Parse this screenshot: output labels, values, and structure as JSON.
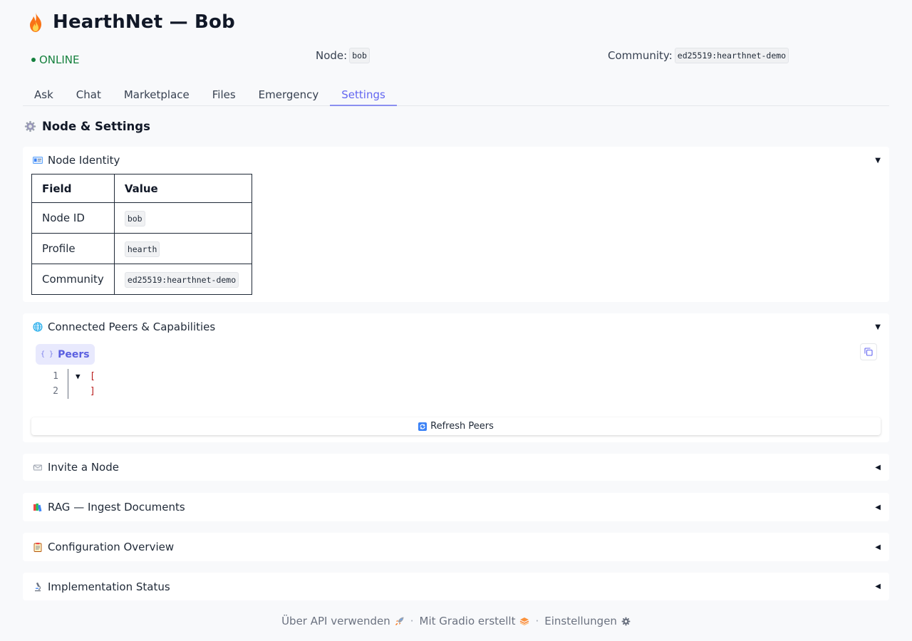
{
  "header": {
    "title": "HearthNet — Bob",
    "status": "ONLINE",
    "node_label": "Node:",
    "node_value": "bob",
    "community_label": "Community:",
    "community_value": "ed25519:hearthnet-demo"
  },
  "tabs": [
    {
      "label": "Ask"
    },
    {
      "label": "Chat"
    },
    {
      "label": "Marketplace"
    },
    {
      "label": "Files"
    },
    {
      "label": "Emergency"
    },
    {
      "label": "Settings",
      "active": true
    }
  ],
  "section": {
    "title": "Node & Settings",
    "icon": "gear-icon"
  },
  "node_identity": {
    "title": "Node Identity",
    "icon": "id-card-icon",
    "headers": [
      "Field",
      "Value"
    ],
    "rows": [
      {
        "field": "Node ID",
        "value": "bob"
      },
      {
        "field": "Profile",
        "value": "hearth"
      },
      {
        "field": "Community",
        "value": "ed25519:hearthnet-demo"
      }
    ]
  },
  "peers": {
    "title": "Connected Peers & Capabilities",
    "icon": "globe-icon",
    "label": "Peers",
    "json_lines": [
      {
        "n": "1",
        "text": "["
      },
      {
        "n": "2",
        "text": "]"
      }
    ],
    "refresh_label": "Refresh Peers"
  },
  "collapsed_sections": [
    {
      "title": "Invite a Node",
      "icon": "envelope-icon"
    },
    {
      "title": "RAG — Ingest Documents",
      "icon": "books-icon"
    },
    {
      "title": "Configuration Overview",
      "icon": "clipboard-icon"
    },
    {
      "title": "Implementation Status",
      "icon": "microscope-icon"
    }
  ],
  "footer": {
    "api": "Über API verwenden",
    "gradio": "Mit Gradio erstellt",
    "settings": "Einstellungen",
    "separator": "·"
  },
  "colors": {
    "accent": "#6366f1",
    "online": "#15803d",
    "background": "#f8f9fb"
  }
}
